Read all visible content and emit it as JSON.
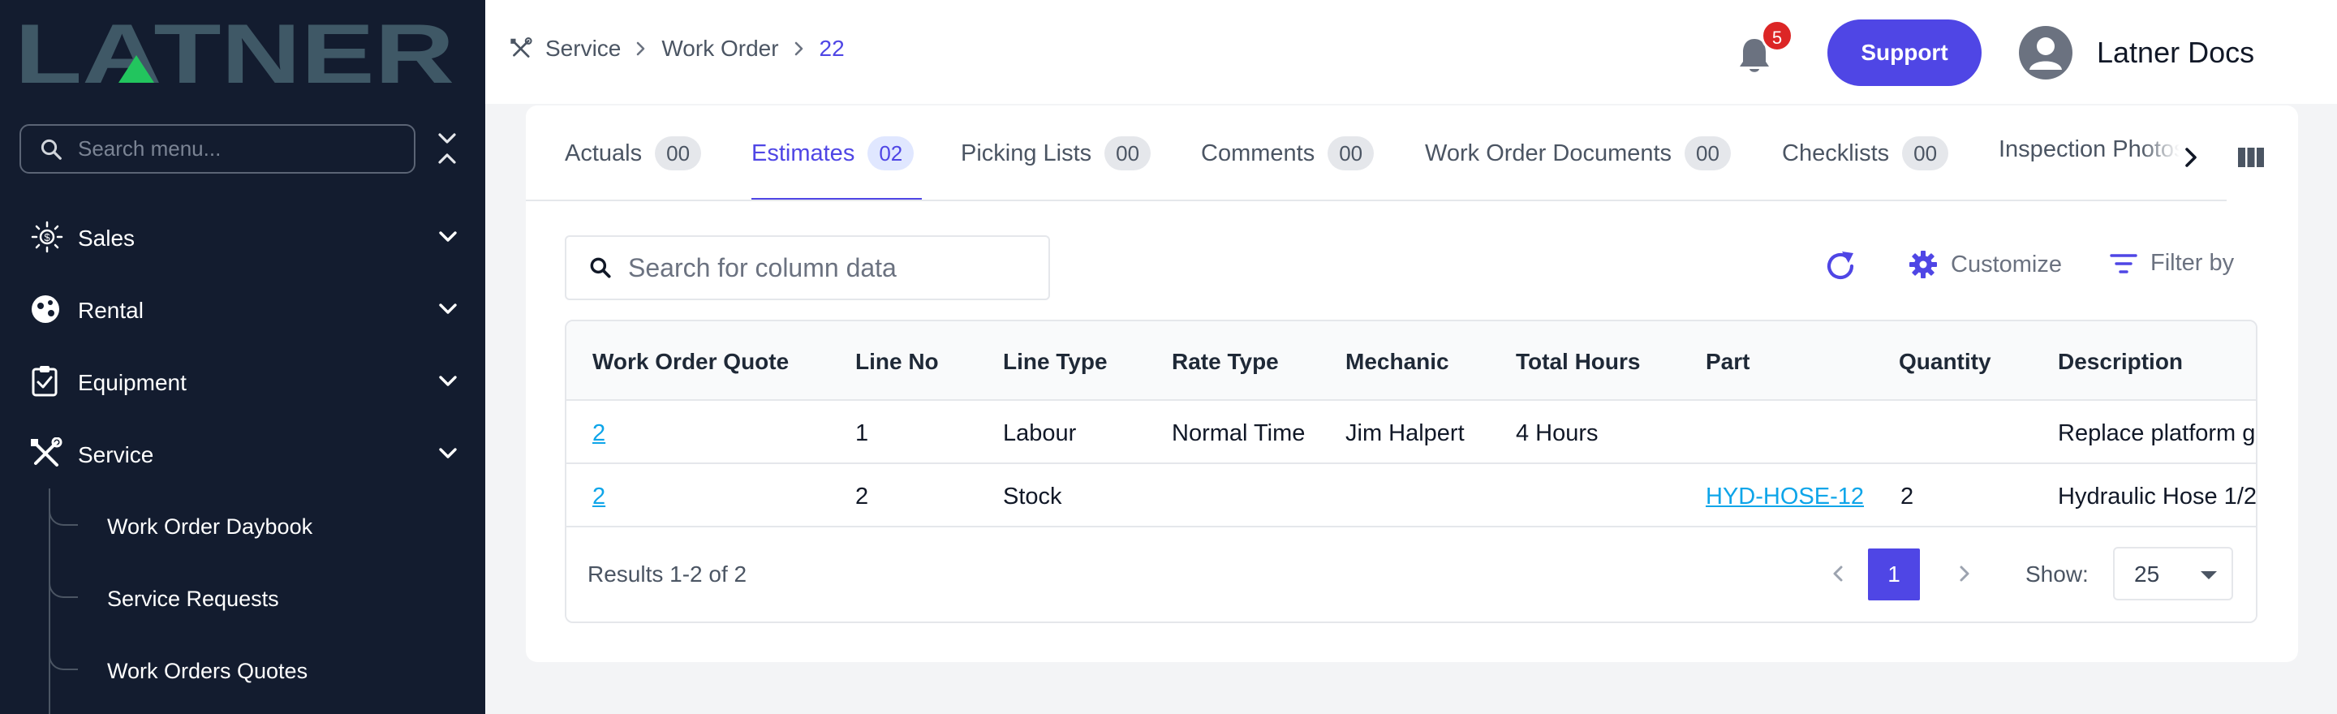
{
  "brand": {
    "logo_text": "LATNER"
  },
  "sidebar": {
    "search_placeholder": "Search menu...",
    "items": [
      {
        "label": "Sales",
        "icon": "sales-icon"
      },
      {
        "label": "Rental",
        "icon": "rental-icon"
      },
      {
        "label": "Equipment",
        "icon": "clipboard-icon"
      },
      {
        "label": "Service",
        "icon": "tools-icon"
      }
    ],
    "service_sub_items": [
      {
        "label": "Work Order Daybook"
      },
      {
        "label": "Service Requests"
      },
      {
        "label": "Work Orders Quotes"
      }
    ]
  },
  "header": {
    "breadcrumb": [
      "Service",
      "Work Order",
      "22"
    ],
    "notification_count": "5",
    "support_label": "Support",
    "user_name": "Latner Docs"
  },
  "tabs": [
    {
      "label": "Actuals",
      "count": "00"
    },
    {
      "label": "Estimates",
      "count": "02"
    },
    {
      "label": "Picking Lists",
      "count": "00"
    },
    {
      "label": "Comments",
      "count": "00"
    },
    {
      "label": "Work Order Documents",
      "count": "00"
    },
    {
      "label": "Checklists",
      "count": "00"
    },
    {
      "label": "Inspection Photos"
    }
  ],
  "active_tab": "Estimates",
  "toolbar": {
    "search_placeholder": "Search for column data",
    "customize_label": "Customize",
    "filter_label": "Filter by"
  },
  "table": {
    "columns": [
      "Work Order Quote",
      "Line No",
      "Line Type",
      "Rate Type",
      "Mechanic",
      "Total Hours",
      "Part",
      "Quantity",
      "Description"
    ],
    "rows": [
      [
        "2",
        "1",
        "Labour",
        "Normal Time",
        "Jim Halpert",
        "4 Hours",
        "",
        "",
        "Replace platform g"
      ],
      [
        "2",
        "2",
        "Stock",
        "",
        "",
        "",
        "HYD-HOSE-12",
        "2",
        "Hydraulic Hose 1/2"
      ]
    ]
  },
  "pagination": {
    "results_text": "Results 1-2 of 2",
    "current_page": "1",
    "show_label": "Show:",
    "page_size": "25"
  },
  "colors": {
    "accent": "#4f46e5",
    "sidebar_bg": "#131c2f",
    "logo": "#3f5866",
    "logo_accent": "#22c55e",
    "link": "#0ea5e9",
    "badge": "#dc2626"
  }
}
